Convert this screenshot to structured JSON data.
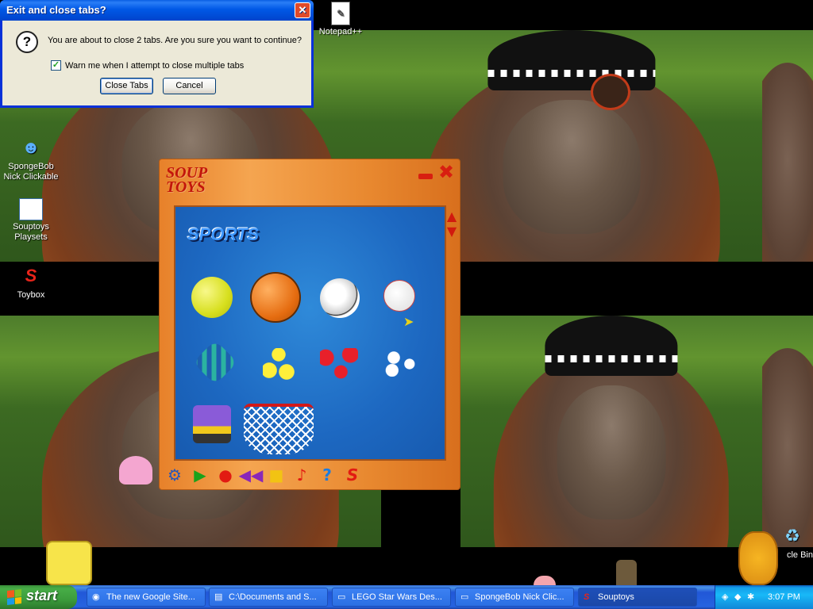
{
  "dialog": {
    "title": "Exit and close tabs?",
    "message": "You are about to close 2 tabs. Are you sure you want to continue?",
    "checkbox_label": "Warn me when I attempt to close multiple tabs",
    "checkbox_checked": true,
    "close_button": "Close Tabs",
    "cancel_button": "Cancel",
    "close_glyph": "✕",
    "question_glyph": "?"
  },
  "desktop_icons": [
    {
      "label": "Notepad++",
      "icon": "notepad-icon"
    },
    {
      "label": "SpongeBob Nick Clickable",
      "icon": "spongebob-icon"
    },
    {
      "label": "Souptoys Playsets",
      "icon": "window-icon"
    },
    {
      "label": "Toybox",
      "icon": "souptoys-s-icon"
    },
    {
      "label": "cle Bin",
      "icon": "recycle-bin-icon"
    }
  ],
  "souptoys": {
    "logo": "SOUP TOYS",
    "section_title": "SPORTS",
    "toys": [
      "tennis-ball",
      "basketball",
      "soccer-ball",
      "baseball",
      "jump-rope",
      "yellow-balls",
      "red-balls",
      "white-balls",
      "roller-skate",
      "basketball-hoop"
    ],
    "toolbar": [
      "robot-icon",
      "play-icon",
      "record-icon",
      "rewind-icon",
      "stop-icon",
      "music-icon",
      "help-icon",
      "souptoys-s-icon"
    ]
  },
  "taskbar": {
    "start_label": "start",
    "items": [
      {
        "label": "The new Google Site...",
        "icon": "web-icon"
      },
      {
        "label": "C:\\Documents and S...",
        "icon": "folder-icon"
      },
      {
        "label": "LEGO Star Wars Des...",
        "icon": "window-icon"
      },
      {
        "label": "SpongeBob Nick Clic...",
        "icon": "window-icon"
      },
      {
        "label": "Souptoys",
        "icon": "souptoys-s-icon"
      }
    ],
    "clock": "3:07 PM"
  },
  "colors": {
    "accent": "#0054e3",
    "start_green": "#3c9c3c",
    "toy_frame": "#e8882f",
    "toy_panel": "#1d68c1"
  }
}
